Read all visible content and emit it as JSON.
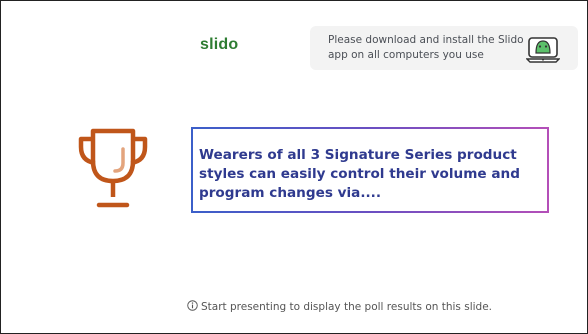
{
  "logo": {
    "text": "slido"
  },
  "notice": {
    "text": "Please download and install the Slido app on all computers you use",
    "icon": "slido-app-icon"
  },
  "poll": {
    "icon": "trophy-icon",
    "question": "Wearers of all 3 Signature Series product styles can easily control their volume and program changes via...."
  },
  "footer": {
    "icon": "info-icon",
    "text": "Start presenting to display the poll results on this slide."
  },
  "colors": {
    "brand_green": "#2e7d32",
    "trophy": "#c0561a",
    "question_text": "#2f3a8f",
    "border_gradient_start": "#3b5fc9",
    "border_gradient_end": "#b44fb8"
  }
}
